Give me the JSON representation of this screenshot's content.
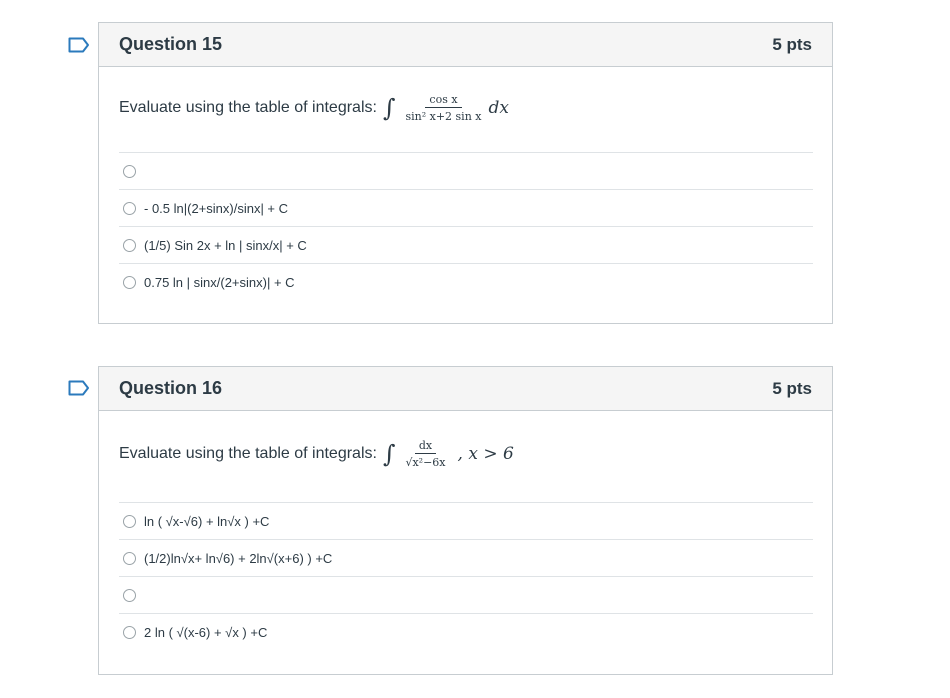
{
  "questions": [
    {
      "title": "Question 15",
      "points": "5 pts",
      "prompt": "Evaluate using the table of integrals:",
      "math": {
        "integral": "∫",
        "numerator": "cos x",
        "denominator": "sin² x+2 sin x",
        "differential": "dx",
        "condition": ""
      },
      "answers": [
        "",
        "- 0.5 ln|(2+sinx)/sinx| + C",
        "(1/5) Sin 2x + ln | sinx/x| + C",
        "0.75 ln | sinx/(2+sinx)| + C"
      ]
    },
    {
      "title": "Question 16",
      "points": "5 pts",
      "prompt": "Evaluate using the table of integrals:",
      "math": {
        "integral": "∫",
        "numerator": "dx",
        "denominator": "√x²−6x",
        "differential": "",
        "condition": ", x > 6"
      },
      "answers": [
        "ln ( √x-√6) + ln√x ) +C",
        "(1/2)ln√x+ ln√6) + 2ln√(x+6) ) +C",
        "",
        "2 ln ( √(x-6) + √x ) +C"
      ]
    }
  ]
}
